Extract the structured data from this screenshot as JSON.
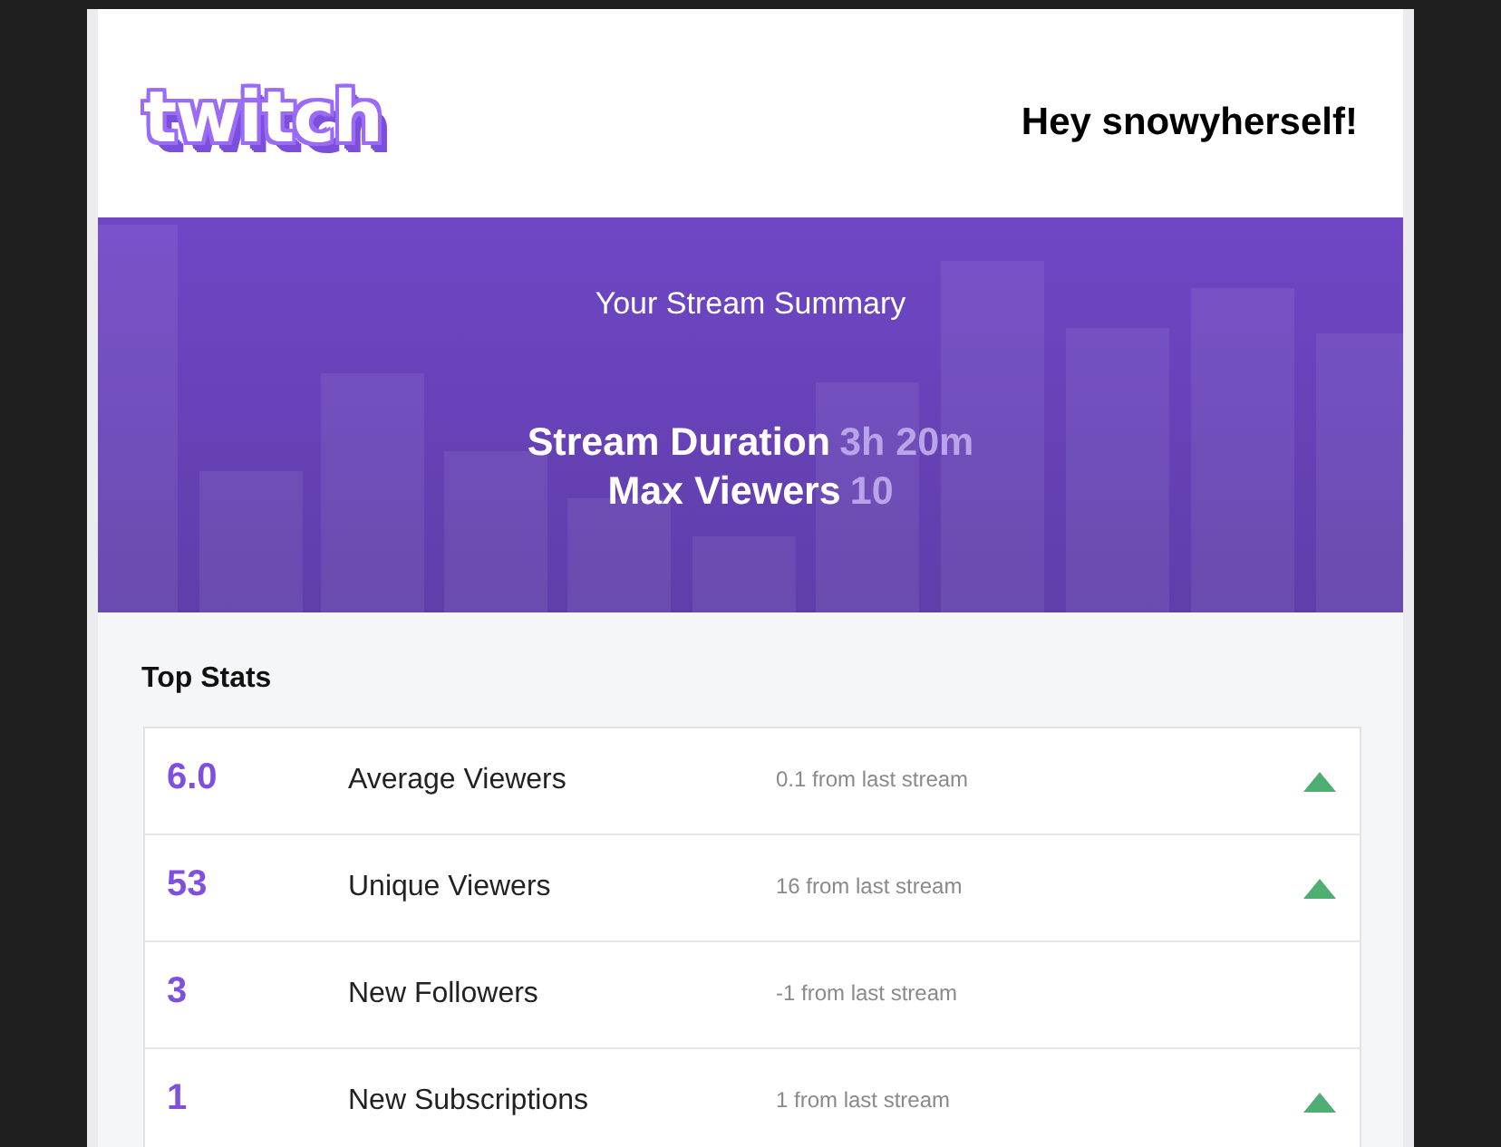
{
  "header": {
    "logo": "twitch",
    "greeting": "Hey snowyherself!"
  },
  "summary": {
    "title": "Your Stream Summary",
    "metrics": [
      {
        "label": "Stream Duration",
        "value": "3h 20m"
      },
      {
        "label": "Max Viewers",
        "value": "10"
      }
    ]
  },
  "top_stats": {
    "title": "Top Stats",
    "rows": [
      {
        "value": "6.0",
        "label": "Average Viewers",
        "change": "0.1 from last stream",
        "up": true
      },
      {
        "value": "53",
        "label": "Unique Viewers",
        "change": "16 from last stream",
        "up": true
      },
      {
        "value": "3",
        "label": "New Followers",
        "change": "-1 from last stream",
        "up": false
      },
      {
        "value": "1",
        "label": "New Subscriptions",
        "change": "1 from last stream",
        "up": true
      }
    ]
  }
}
